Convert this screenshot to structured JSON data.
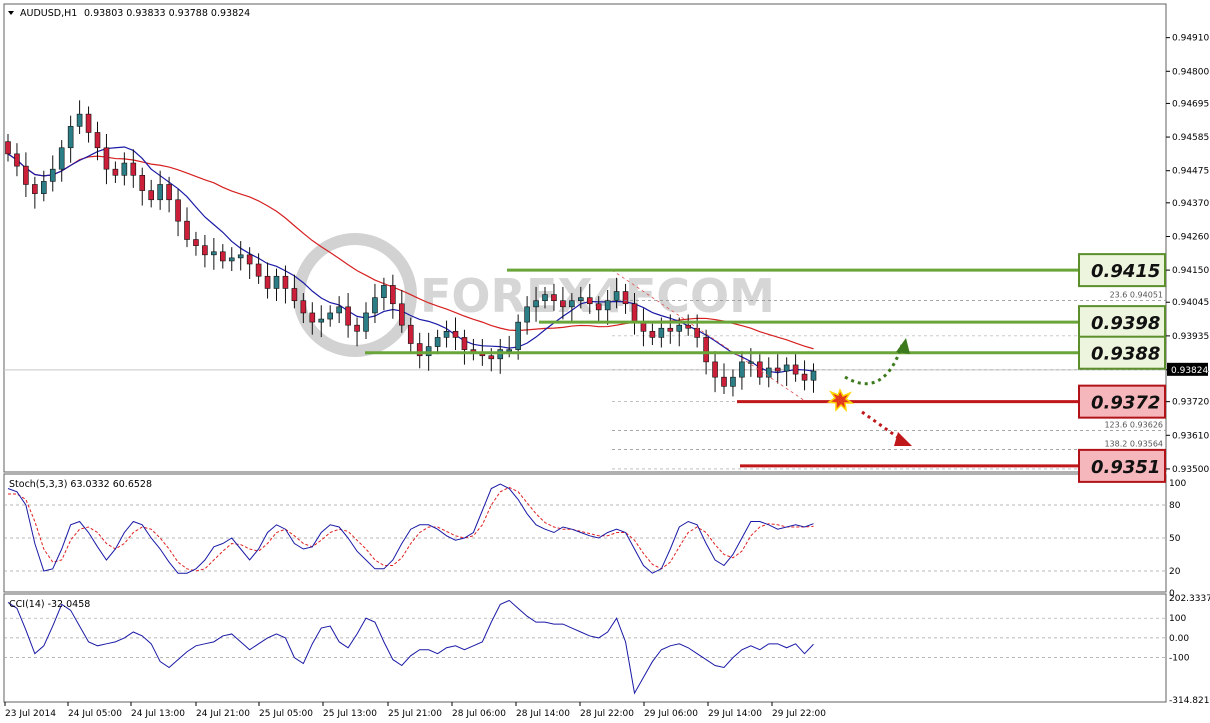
{
  "header": {
    "symbol": "AUDUSD,H1",
    "ohlc": "0.93803 0.93833 0.93788 0.93824"
  },
  "watermark": "FOREX4FCOM",
  "colors": {
    "bull": "#2b7e86",
    "bear": "#cc1f3a",
    "ma_fast": "#1a1aa6",
    "ma_slow": "#d62020",
    "resistance": "#6aa53a",
    "support": "#c0171a",
    "stoch_main": "#1a1aa6",
    "stoch_signal": "#e02020",
    "cci": "#1a1aa6"
  },
  "chart_data": [
    {
      "type": "candlestick",
      "symbol": "AUDUSD",
      "timeframe": "H1",
      "ylim": [
        0.9349,
        0.9502
      ],
      "y_ticks": [
        "0.94910",
        "0.94800",
        "0.94695",
        "0.94585",
        "0.94475",
        "0.94370",
        "0.94260",
        "0.94150",
        "0.94045",
        "0.93935",
        "0.93824",
        "0.93720",
        "0.93610",
        "0.93500"
      ],
      "current_price": "0.93824",
      "x_ticks": [
        "23 Jul 2014",
        "24 Jul 05:00",
        "24 Jul 13:00",
        "24 Jul 21:00",
        "25 Jul 05:00",
        "25 Jul 13:00",
        "25 Jul 21:00",
        "28 Jul 06:00",
        "28 Jul 14:00",
        "28 Jul 22:00",
        "29 Jul 06:00",
        "29 Jul 14:00",
        "29 Jul 22:00"
      ],
      "close_series": [
        0.9453,
        0.9449,
        0.9443,
        0.944,
        0.9444,
        0.9448,
        0.9455,
        0.9462,
        0.9466,
        0.946,
        0.9455,
        0.9448,
        0.9446,
        0.945,
        0.9446,
        0.9441,
        0.9438,
        0.9443,
        0.9438,
        0.9431,
        0.9425,
        0.9423,
        0.942,
        0.9421,
        0.9418,
        0.9419,
        0.942,
        0.9417,
        0.9413,
        0.9409,
        0.9413,
        0.9409,
        0.9405,
        0.9401,
        0.9398,
        0.9399,
        0.9401,
        0.9403,
        0.9397,
        0.9395,
        0.9401,
        0.9406,
        0.941,
        0.9404,
        0.9397,
        0.9391,
        0.9387,
        0.939,
        0.9393,
        0.9395,
        0.9393,
        0.9389,
        0.9388,
        0.9387,
        0.9386,
        0.9389,
        0.9389,
        0.9398,
        0.9403,
        0.9405,
        0.9407,
        0.9405,
        0.9403,
        0.9405,
        0.9406,
        0.9404,
        0.9402,
        0.9405,
        0.9408,
        0.9404,
        0.9398,
        0.9395,
        0.9393,
        0.9396,
        0.9395,
        0.9397,
        0.9396,
        0.9393,
        0.9385,
        0.938,
        0.9377,
        0.938,
        0.9385,
        0.9385,
        0.938,
        0.9383,
        0.9382,
        0.9384,
        0.9381,
        0.9379,
        0.9382
      ],
      "levels": [
        {
          "label": "0.9415",
          "kind": "resistance",
          "value": 0.9415
        },
        {
          "label": "0.9398",
          "kind": "resistance",
          "value": 0.9398
        },
        {
          "label": "0.9388",
          "kind": "resistance",
          "value": 0.9388
        },
        {
          "label": "0.9372",
          "kind": "support",
          "value": 0.9372
        },
        {
          "label": "0.9351",
          "kind": "support",
          "value": 0.9351
        }
      ],
      "fibonacci": [
        {
          "label": "23.6 0.94051",
          "value": 0.94051
        },
        {
          "label": "123.6 0.93626",
          "value": 0.93626
        },
        {
          "label": "138.2 0.93564",
          "value": 0.93564
        }
      ]
    },
    {
      "type": "line",
      "name": "Stoch(5,3,3) 63.0332 60.6528",
      "ylim": [
        0,
        100
      ],
      "y_ticks": [
        "100",
        "80",
        "50",
        "20",
        "0"
      ],
      "main": [
        95,
        92,
        80,
        45,
        20,
        22,
        40,
        62,
        65,
        55,
        42,
        30,
        40,
        55,
        65,
        62,
        50,
        40,
        28,
        18,
        18,
        22,
        30,
        42,
        45,
        50,
        40,
        30,
        40,
        55,
        62,
        58,
        45,
        40,
        42,
        55,
        62,
        60,
        50,
        38,
        30,
        22,
        22,
        30,
        45,
        58,
        62,
        62,
        58,
        52,
        48,
        50,
        55,
        75,
        95,
        99,
        95,
        85,
        72,
        62,
        58,
        55,
        60,
        58,
        55,
        52,
        50,
        55,
        58,
        55,
        40,
        25,
        18,
        22,
        40,
        60,
        65,
        62,
        45,
        30,
        25,
        35,
        50,
        65,
        65,
        62,
        58,
        60,
        62,
        60,
        63
      ],
      "signal": [
        90,
        90,
        85,
        65,
        40,
        28,
        30,
        48,
        58,
        60,
        55,
        45,
        40,
        45,
        55,
        60,
        58,
        50,
        40,
        28,
        22,
        20,
        22,
        30,
        38,
        45,
        44,
        40,
        38,
        45,
        55,
        58,
        52,
        45,
        42,
        48,
        55,
        58,
        56,
        48,
        40,
        30,
        25,
        25,
        32,
        45,
        55,
        60,
        60,
        56,
        52,
        50,
        52,
        62,
        80,
        92,
        96,
        92,
        82,
        72,
        64,
        60,
        58,
        58,
        56,
        54,
        52,
        52,
        55,
        55,
        48,
        36,
        26,
        22,
        28,
        42,
        55,
        60,
        55,
        44,
        35,
        32,
        38,
        52,
        60,
        63,
        62,
        60,
        60,
        60,
        60.65
      ]
    },
    {
      "type": "line",
      "name": "CCI(14) -32.0458",
      "ylim": [
        -314.8211,
        202.3337
      ],
      "y_ticks": [
        "202.3337",
        "100",
        "0.00",
        "-100",
        "-314.8211"
      ],
      "values": [
        180,
        150,
        40,
        -80,
        -40,
        60,
        170,
        140,
        60,
        -20,
        -40,
        -30,
        -20,
        0,
        30,
        10,
        -30,
        -120,
        -150,
        -110,
        -70,
        -40,
        -30,
        -20,
        10,
        20,
        -20,
        -60,
        -30,
        0,
        20,
        0,
        -100,
        -130,
        -30,
        50,
        60,
        -20,
        -50,
        20,
        100,
        80,
        -20,
        -110,
        -140,
        -90,
        -60,
        -60,
        -80,
        -50,
        -40,
        -60,
        -40,
        -20,
        80,
        170,
        190,
        150,
        110,
        80,
        80,
        70,
        70,
        50,
        30,
        10,
        0,
        30,
        100,
        -20,
        -280,
        -200,
        -120,
        -60,
        -40,
        -30,
        -50,
        -80,
        -110,
        -140,
        -150,
        -100,
        -60,
        -40,
        -60,
        -30,
        -30,
        -50,
        -30,
        -80,
        -32.0458
      ]
    }
  ]
}
